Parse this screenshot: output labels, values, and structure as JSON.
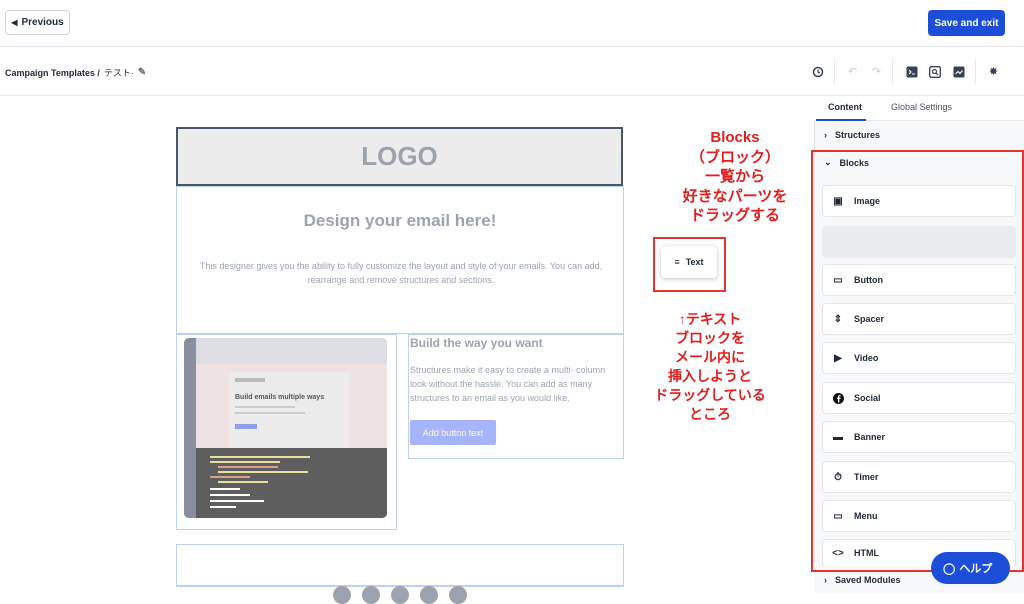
{
  "topbar": {
    "previous_label": "Previous",
    "save_label": "Save and exit"
  },
  "breadcrumb": {
    "root": "Campaign Templates /",
    "current": "テスト·"
  },
  "email": {
    "logo_text": "LOGO",
    "hero_title": "Design your email here!",
    "hero_text": "This designer gives you the ability to fully customize the layout and style of your emails. You can add, rearrange and remove structures and sections.",
    "build_title": "Build the way you want",
    "build_text": "Structures make it easy to create a multi- column look without the hassle. You can add as many structures to an email as you would like.",
    "button_label": "Add button text",
    "shot_card_title": "Build emails multiple ways"
  },
  "drag_chip": {
    "label": "Text"
  },
  "annotations": {
    "blocks_note": [
      "Blocks",
      "（ブロック）",
      "一覧から",
      "好きなパーツを",
      "ドラッグする"
    ],
    "text_note": [
      "↑テキスト",
      "ブロックを",
      "メール内に",
      "挿入しようと",
      "ドラッグしている",
      "ところ"
    ]
  },
  "panel": {
    "tabs": [
      {
        "label": "Content"
      },
      {
        "label": "Global Settings"
      }
    ],
    "structures_label": "Structures",
    "blocks_label": "Blocks",
    "saved_label": "Saved Modules",
    "blocks": [
      {
        "label": "Image",
        "icon": "image-icon"
      },
      {
        "label": "Button",
        "icon": "button-icon"
      },
      {
        "label": "Spacer",
        "icon": "spacer-icon"
      },
      {
        "label": "Video",
        "icon": "video-icon"
      },
      {
        "label": "Social",
        "icon": "facebook-icon"
      },
      {
        "label": "Banner",
        "icon": "banner-icon"
      },
      {
        "label": "Timer",
        "icon": "timer-icon"
      },
      {
        "label": "Menu",
        "icon": "menu-icon"
      },
      {
        "label": "HTML",
        "icon": "code-icon"
      }
    ]
  },
  "help": {
    "label": "ヘルプ"
  },
  "colors": {
    "accent": "#1d4ed8",
    "annotation": "#e11d1d"
  }
}
